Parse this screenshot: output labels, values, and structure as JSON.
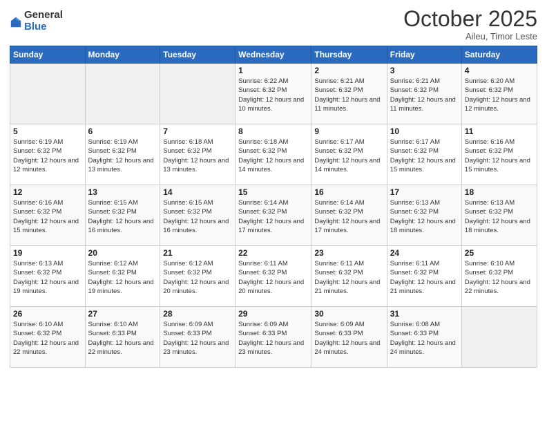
{
  "logo": {
    "general": "General",
    "blue": "Blue"
  },
  "header": {
    "title": "October 2025",
    "subtitle": "Aileu, Timor Leste"
  },
  "columns": [
    "Sunday",
    "Monday",
    "Tuesday",
    "Wednesday",
    "Thursday",
    "Friday",
    "Saturday"
  ],
  "weeks": [
    [
      {
        "day": "",
        "info": ""
      },
      {
        "day": "",
        "info": ""
      },
      {
        "day": "",
        "info": ""
      },
      {
        "day": "1",
        "info": "Sunrise: 6:22 AM\nSunset: 6:32 PM\nDaylight: 12 hours and 10 minutes."
      },
      {
        "day": "2",
        "info": "Sunrise: 6:21 AM\nSunset: 6:32 PM\nDaylight: 12 hours and 11 minutes."
      },
      {
        "day": "3",
        "info": "Sunrise: 6:21 AM\nSunset: 6:32 PM\nDaylight: 12 hours and 11 minutes."
      },
      {
        "day": "4",
        "info": "Sunrise: 6:20 AM\nSunset: 6:32 PM\nDaylight: 12 hours and 12 minutes."
      }
    ],
    [
      {
        "day": "5",
        "info": "Sunrise: 6:19 AM\nSunset: 6:32 PM\nDaylight: 12 hours and 12 minutes."
      },
      {
        "day": "6",
        "info": "Sunrise: 6:19 AM\nSunset: 6:32 PM\nDaylight: 12 hours and 13 minutes."
      },
      {
        "day": "7",
        "info": "Sunrise: 6:18 AM\nSunset: 6:32 PM\nDaylight: 12 hours and 13 minutes."
      },
      {
        "day": "8",
        "info": "Sunrise: 6:18 AM\nSunset: 6:32 PM\nDaylight: 12 hours and 14 minutes."
      },
      {
        "day": "9",
        "info": "Sunrise: 6:17 AM\nSunset: 6:32 PM\nDaylight: 12 hours and 14 minutes."
      },
      {
        "day": "10",
        "info": "Sunrise: 6:17 AM\nSunset: 6:32 PM\nDaylight: 12 hours and 15 minutes."
      },
      {
        "day": "11",
        "info": "Sunrise: 6:16 AM\nSunset: 6:32 PM\nDaylight: 12 hours and 15 minutes."
      }
    ],
    [
      {
        "day": "12",
        "info": "Sunrise: 6:16 AM\nSunset: 6:32 PM\nDaylight: 12 hours and 15 minutes."
      },
      {
        "day": "13",
        "info": "Sunrise: 6:15 AM\nSunset: 6:32 PM\nDaylight: 12 hours and 16 minutes."
      },
      {
        "day": "14",
        "info": "Sunrise: 6:15 AM\nSunset: 6:32 PM\nDaylight: 12 hours and 16 minutes."
      },
      {
        "day": "15",
        "info": "Sunrise: 6:14 AM\nSunset: 6:32 PM\nDaylight: 12 hours and 17 minutes."
      },
      {
        "day": "16",
        "info": "Sunrise: 6:14 AM\nSunset: 6:32 PM\nDaylight: 12 hours and 17 minutes."
      },
      {
        "day": "17",
        "info": "Sunrise: 6:13 AM\nSunset: 6:32 PM\nDaylight: 12 hours and 18 minutes."
      },
      {
        "day": "18",
        "info": "Sunrise: 6:13 AM\nSunset: 6:32 PM\nDaylight: 12 hours and 18 minutes."
      }
    ],
    [
      {
        "day": "19",
        "info": "Sunrise: 6:13 AM\nSunset: 6:32 PM\nDaylight: 12 hours and 19 minutes."
      },
      {
        "day": "20",
        "info": "Sunrise: 6:12 AM\nSunset: 6:32 PM\nDaylight: 12 hours and 19 minutes."
      },
      {
        "day": "21",
        "info": "Sunrise: 6:12 AM\nSunset: 6:32 PM\nDaylight: 12 hours and 20 minutes."
      },
      {
        "day": "22",
        "info": "Sunrise: 6:11 AM\nSunset: 6:32 PM\nDaylight: 12 hours and 20 minutes."
      },
      {
        "day": "23",
        "info": "Sunrise: 6:11 AM\nSunset: 6:32 PM\nDaylight: 12 hours and 21 minutes."
      },
      {
        "day": "24",
        "info": "Sunrise: 6:11 AM\nSunset: 6:32 PM\nDaylight: 12 hours and 21 minutes."
      },
      {
        "day": "25",
        "info": "Sunrise: 6:10 AM\nSunset: 6:32 PM\nDaylight: 12 hours and 22 minutes."
      }
    ],
    [
      {
        "day": "26",
        "info": "Sunrise: 6:10 AM\nSunset: 6:32 PM\nDaylight: 12 hours and 22 minutes."
      },
      {
        "day": "27",
        "info": "Sunrise: 6:10 AM\nSunset: 6:33 PM\nDaylight: 12 hours and 22 minutes."
      },
      {
        "day": "28",
        "info": "Sunrise: 6:09 AM\nSunset: 6:33 PM\nDaylight: 12 hours and 23 minutes."
      },
      {
        "day": "29",
        "info": "Sunrise: 6:09 AM\nSunset: 6:33 PM\nDaylight: 12 hours and 23 minutes."
      },
      {
        "day": "30",
        "info": "Sunrise: 6:09 AM\nSunset: 6:33 PM\nDaylight: 12 hours and 24 minutes."
      },
      {
        "day": "31",
        "info": "Sunrise: 6:08 AM\nSunset: 6:33 PM\nDaylight: 12 hours and 24 minutes."
      },
      {
        "day": "",
        "info": ""
      }
    ]
  ]
}
